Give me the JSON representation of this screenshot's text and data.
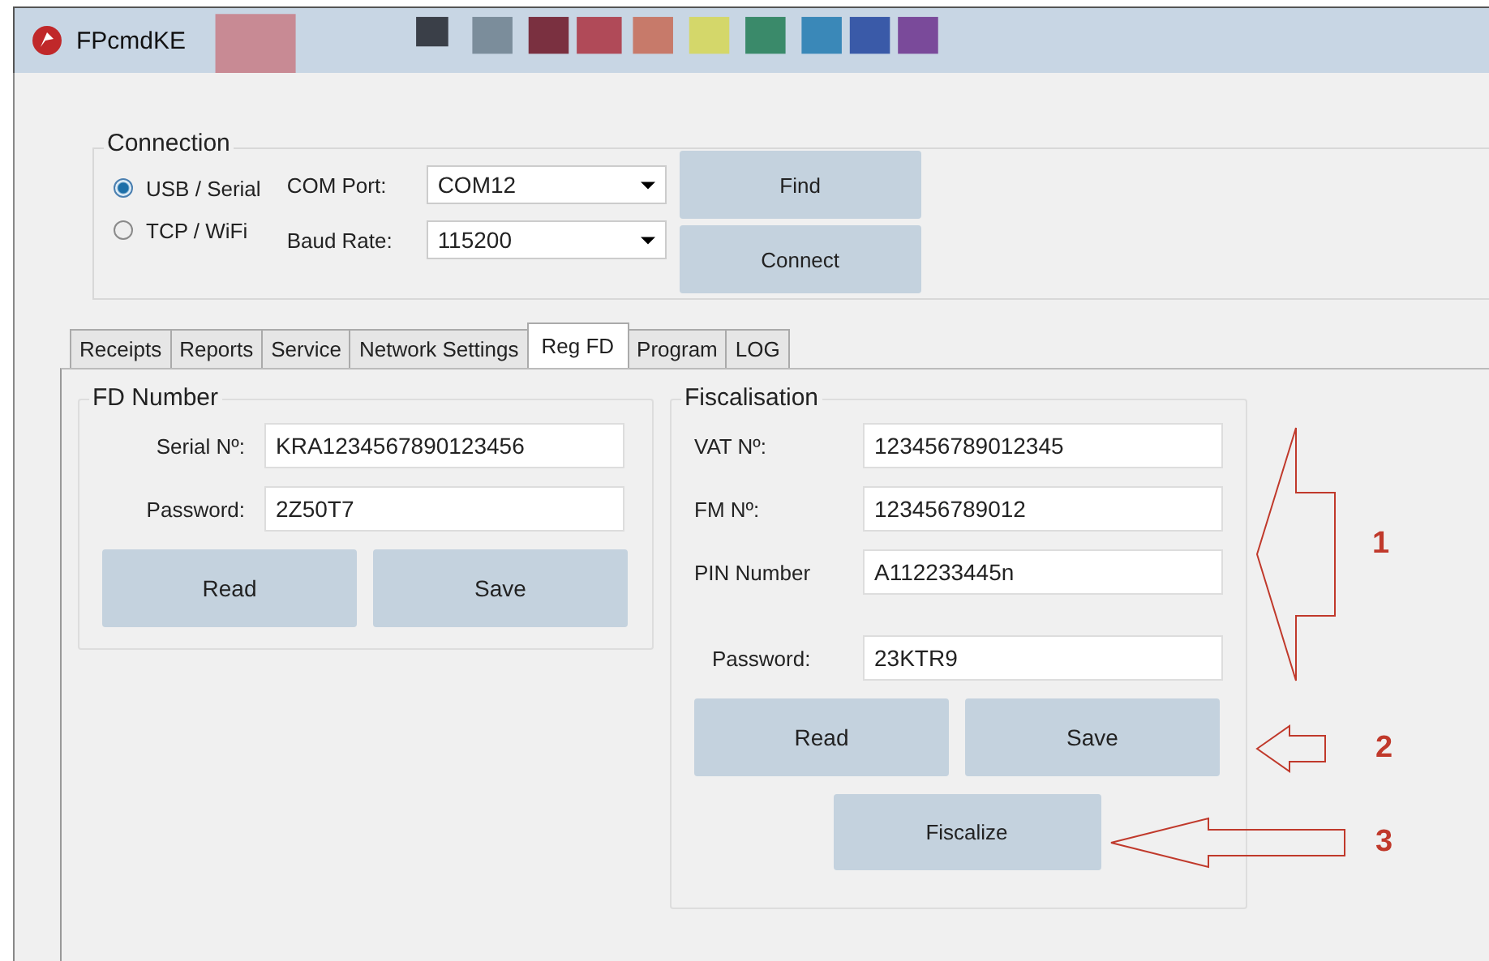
{
  "window": {
    "title": "FPcmdKE"
  },
  "connection": {
    "title": "Connection",
    "modes": [
      {
        "label": "USB / Serial",
        "selected": true
      },
      {
        "label": "TCP / WiFi",
        "selected": false
      }
    ],
    "fields": [
      {
        "label": "COM Port:",
        "value": "COM12"
      },
      {
        "label": "Baud Rate:",
        "value": "115200"
      }
    ],
    "buttons": [
      "Find",
      "Connect"
    ]
  },
  "tabs": [
    {
      "label": "Receipts",
      "selected": false
    },
    {
      "label": "Reports",
      "selected": false
    },
    {
      "label": "Service",
      "selected": false
    },
    {
      "label": "Network Settings",
      "selected": false
    },
    {
      "label": "Reg FD",
      "selected": true
    },
    {
      "label": "Program",
      "selected": false
    },
    {
      "label": "LOG",
      "selected": false
    }
  ],
  "fd_number": {
    "title": "FD Number",
    "fields": [
      {
        "label": "Serial Nº:",
        "value": "KRA1234567890123456"
      },
      {
        "label": "Password:",
        "value": "2Z50T7"
      }
    ],
    "buttons": [
      "Read",
      "Save"
    ]
  },
  "fiscalisation": {
    "title": "Fiscalisation",
    "fields": [
      {
        "label": "VAT Nº:",
        "value": "123456789012345"
      },
      {
        "label": "FM Nº:",
        "value": "123456789012"
      },
      {
        "label": "PIN Number",
        "value": "A112233445n"
      }
    ],
    "password": {
      "label": "Password:",
      "value": "23KTR9"
    },
    "buttons": [
      "Read",
      "Save"
    ],
    "fiscalize_button": "Fiscalize"
  },
  "annotations": [
    {
      "label": "1"
    },
    {
      "label": "2"
    },
    {
      "label": "3"
    }
  ]
}
